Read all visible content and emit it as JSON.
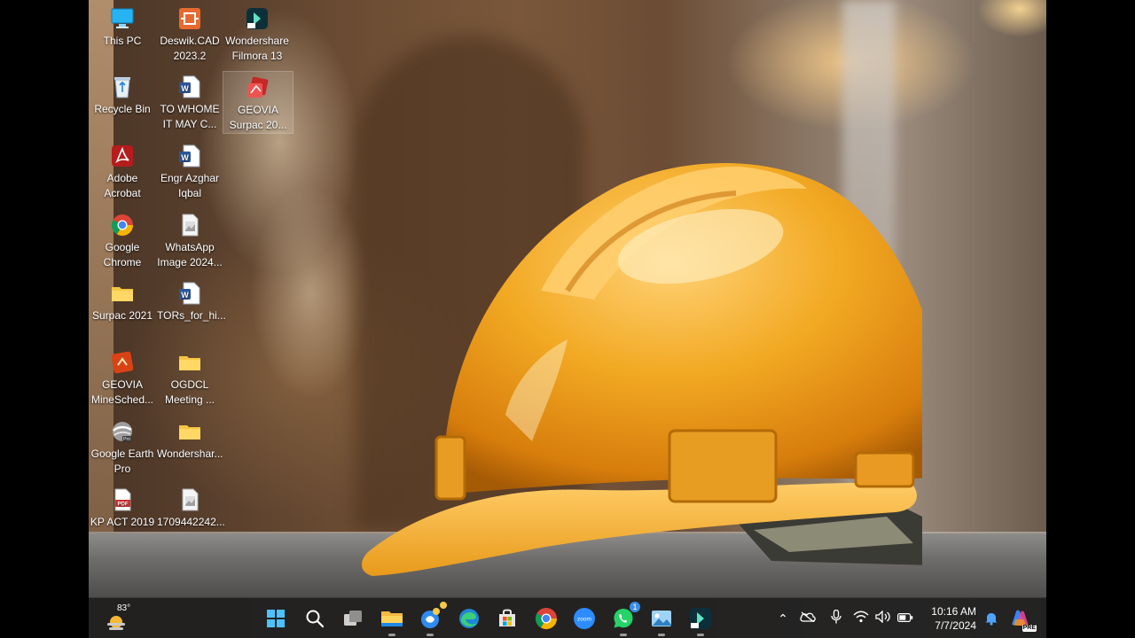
{
  "desktop": {
    "icons": [
      {
        "id": "this-pc",
        "label": "This PC",
        "icon": "monitor-icon"
      },
      {
        "id": "deswik",
        "label": "Deswik.CAD\n2023.2",
        "icon": "deswik-icon"
      },
      {
        "id": "filmora",
        "label": "Wondershare\nFilmora 13",
        "icon": "filmora-icon"
      },
      {
        "id": "recycle",
        "label": "Recycle Bin",
        "icon": "recycle-bin-icon"
      },
      {
        "id": "to-whome",
        "label": "TO WHOME\nIT MAY C...",
        "icon": "word-doc-icon"
      },
      {
        "id": "geovia-surpac",
        "label": "GEOVIA\nSurpac 20...",
        "icon": "surpac-icon"
      },
      {
        "id": "acrobat",
        "label": "Adobe\nAcrobat",
        "icon": "acrobat-icon"
      },
      {
        "id": "engr",
        "label": "Engr Azghar\nIqbal",
        "icon": "word-doc-icon"
      },
      {
        "id": "chrome",
        "label": "Google\nChrome",
        "icon": "chrome-icon"
      },
      {
        "id": "whatsapp-img",
        "label": "WhatsApp\nImage 2024...",
        "icon": "image-file-icon"
      },
      {
        "id": "surpac2021",
        "label": "Surpac 2021",
        "icon": "folder-icon"
      },
      {
        "id": "tors",
        "label": "TORs_for_hi...",
        "icon": "word-doc-icon"
      },
      {
        "id": "minesched",
        "label": "GEOVIA\nMineSched...",
        "icon": "minesched-icon"
      },
      {
        "id": "ogdcl",
        "label": "OGDCL\nMeeting ...",
        "icon": "folder-icon"
      },
      {
        "id": "earth",
        "label": "Google Earth\nPro",
        "icon": "google-earth-icon"
      },
      {
        "id": "wondershar",
        "label": "Wondershar...",
        "icon": "folder-icon"
      },
      {
        "id": "kpact",
        "label": "KP ACT 2019",
        "icon": "pdf-icon"
      },
      {
        "id": "img1709",
        "label": "1709442242...",
        "icon": "image-file-icon"
      }
    ]
  },
  "taskbar": {
    "weather_temp": "83°",
    "apps": [
      {
        "name": "start",
        "icon": "windows-start-icon"
      },
      {
        "name": "search",
        "icon": "search-icon"
      },
      {
        "name": "task-view",
        "icon": "task-view-icon"
      },
      {
        "name": "file-explorer",
        "icon": "file-explorer-icon"
      },
      {
        "name": "copilot-app",
        "icon": "copilot-app-icon"
      },
      {
        "name": "edge",
        "icon": "edge-icon"
      },
      {
        "name": "store",
        "icon": "store-icon"
      },
      {
        "name": "chrome",
        "icon": "chrome-icon"
      },
      {
        "name": "zoom",
        "icon": "zoom-icon",
        "label": "zoom"
      },
      {
        "name": "whatsapp",
        "icon": "whatsapp-icon",
        "badge": "1"
      },
      {
        "name": "photos",
        "icon": "photos-icon"
      },
      {
        "name": "filmora",
        "icon": "filmora-icon"
      }
    ],
    "clock_time": "10:16 AM",
    "clock_date": "7/7/2024",
    "copilot_badge": "PRE"
  },
  "colors": {
    "taskbar_bg": "#202020",
    "helmet": "#f0a91e",
    "word_blue": "#2b579a",
    "pdf_red": "#d32f2f",
    "folder_yellow": "#f4c542"
  }
}
